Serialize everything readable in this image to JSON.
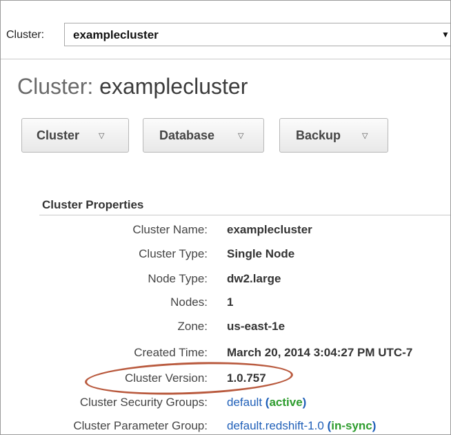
{
  "cluster_bar": {
    "label": "Cluster:",
    "selected": "examplecluster"
  },
  "page_title": {
    "prefix": "Cluster:",
    "name": "examplecluster"
  },
  "toolbar": {
    "cluster": "Cluster",
    "database": "Database",
    "backup": "Backup"
  },
  "properties": {
    "title": "Cluster Properties",
    "cluster_name": {
      "label": "Cluster Name:",
      "value": "examplecluster"
    },
    "cluster_type": {
      "label": "Cluster Type:",
      "value": "Single Node"
    },
    "node_type": {
      "label": "Node Type:",
      "value": "dw2.large"
    },
    "nodes": {
      "label": "Nodes:",
      "value": "1"
    },
    "zone": {
      "label": "Zone:",
      "value": "us-east-1e"
    },
    "created_time": {
      "label": "Created Time:",
      "value": "March 20, 2014 3:04:27 PM UTC-7"
    },
    "cluster_version": {
      "label": "Cluster Version:",
      "value": "1.0.757"
    },
    "security_groups": {
      "label": "Cluster Security Groups:",
      "link": "default",
      "open": "(",
      "status": "active",
      "close": ")"
    },
    "parameter_group": {
      "label": "Cluster Parameter Group:",
      "link": "default.redshift-1.0",
      "open": "(",
      "status": "in-sync",
      "close": ")"
    }
  },
  "colors": {
    "link": "#1f5fb8",
    "status_ok": "#2e9c2e",
    "highlight": "#b95a3e"
  }
}
